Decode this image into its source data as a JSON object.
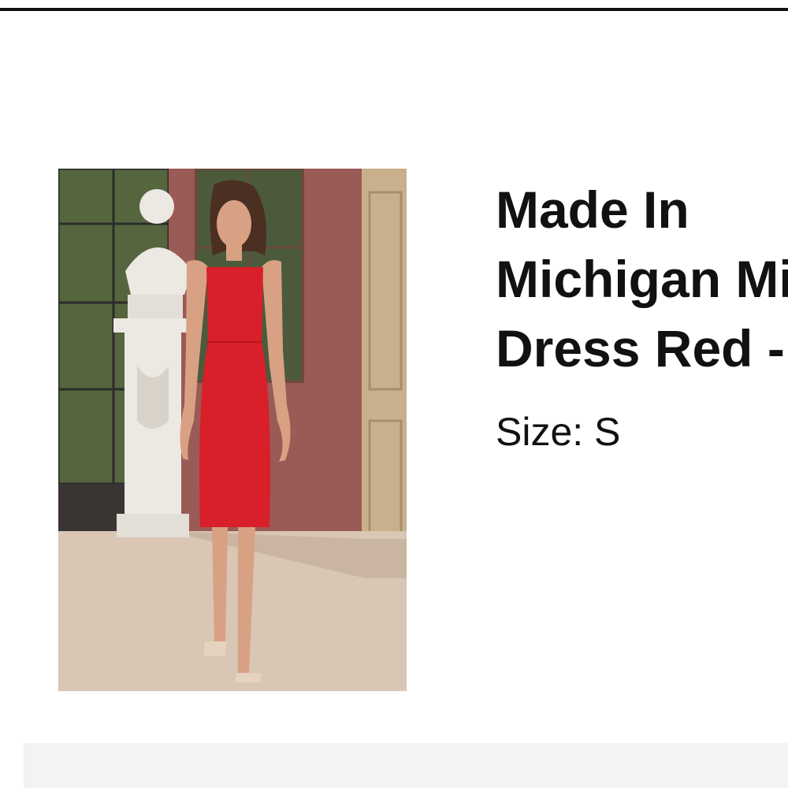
{
  "product": {
    "title": "Made In\nMichigan Midi\nDress Red -",
    "size_text": "Size: S",
    "image": {
      "alt": "Model in red midi dress beside a white statue",
      "subject": "red-midi-dress",
      "colors": {
        "dress": "#d91f2a",
        "wall": "#9a5a55",
        "floor": "#d9c6b4",
        "statue": "#ece8e2",
        "door": "#c9b08c",
        "foliage": "#55653e"
      }
    }
  },
  "colors": {
    "text": "#111111",
    "rule": "#111111",
    "bottom_panel": "#f3f3f3"
  }
}
